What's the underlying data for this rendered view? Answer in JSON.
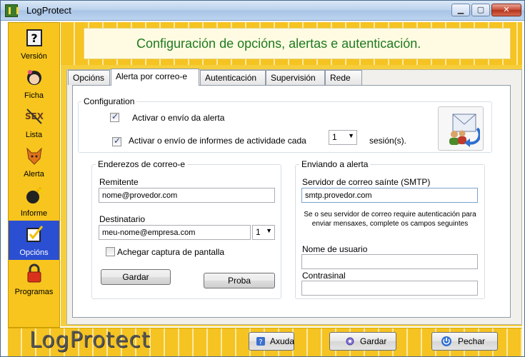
{
  "window": {
    "title": "LogProtect"
  },
  "sidebar": {
    "items": [
      {
        "label": "Versión",
        "icon": "question-book-icon"
      },
      {
        "label": "Ficha",
        "icon": "person-face-icon"
      },
      {
        "label": "Lista",
        "icon": "sex-badge-icon"
      },
      {
        "label": "Alerta",
        "icon": "fox-alert-icon"
      },
      {
        "label": "Informe",
        "icon": "bomb-report-icon"
      },
      {
        "label": "Opcións",
        "icon": "checklist-icon",
        "active": true
      },
      {
        "label": "Programas",
        "icon": "padlock-icon"
      }
    ]
  },
  "header": {
    "title": "Configuración de opcións, alertas e autenticación."
  },
  "tabs": [
    {
      "label": "Opcións"
    },
    {
      "label": "Alerta por correo-e",
      "active": true
    },
    {
      "label": "Autenticación"
    },
    {
      "label": "Supervisión"
    },
    {
      "label": "Rede"
    }
  ],
  "config": {
    "title": "Configuration",
    "enable_alert": {
      "label": "Activar o envío da alerta",
      "checked": true
    },
    "enable_reports": {
      "label": "Activar o envío de informes de actividade cada",
      "checked": true
    },
    "sessions_value": "1",
    "sessions_suffix": "sesión(s)."
  },
  "addresses": {
    "title": "Enderezos de correo-e",
    "sender_label": "Remitente",
    "sender_value": "nome@provedor.com",
    "recipient_label": "Destinatario",
    "recipient_value": "meu-nome@empresa.com",
    "recipient_index": "1",
    "screenshot_label": "Achegar captura de pantalla",
    "screenshot_checked": false,
    "save_label": "Gardar",
    "test_label": "Proba"
  },
  "sending": {
    "title": "Enviando a alerta",
    "smtp_label": "Servidor de correo saínte (SMTP)",
    "smtp_value": "smtp.provedor.com",
    "auth_note": "Se o seu servidor de correo require autenticación para enviar mensaxes, complete os campos seguintes",
    "username_label": "Nome de usuario",
    "username_value": "",
    "password_label": "Contrasinal",
    "password_value": ""
  },
  "footer": {
    "logo": "LogProtect",
    "help_label": "Axuda",
    "save_label": "Gardar",
    "close_label": "Pechar"
  },
  "colors": {
    "accent_yellow": "#f6ce3c",
    "active_blue": "#2b4fd2",
    "title_green": "#1f7a1f"
  }
}
